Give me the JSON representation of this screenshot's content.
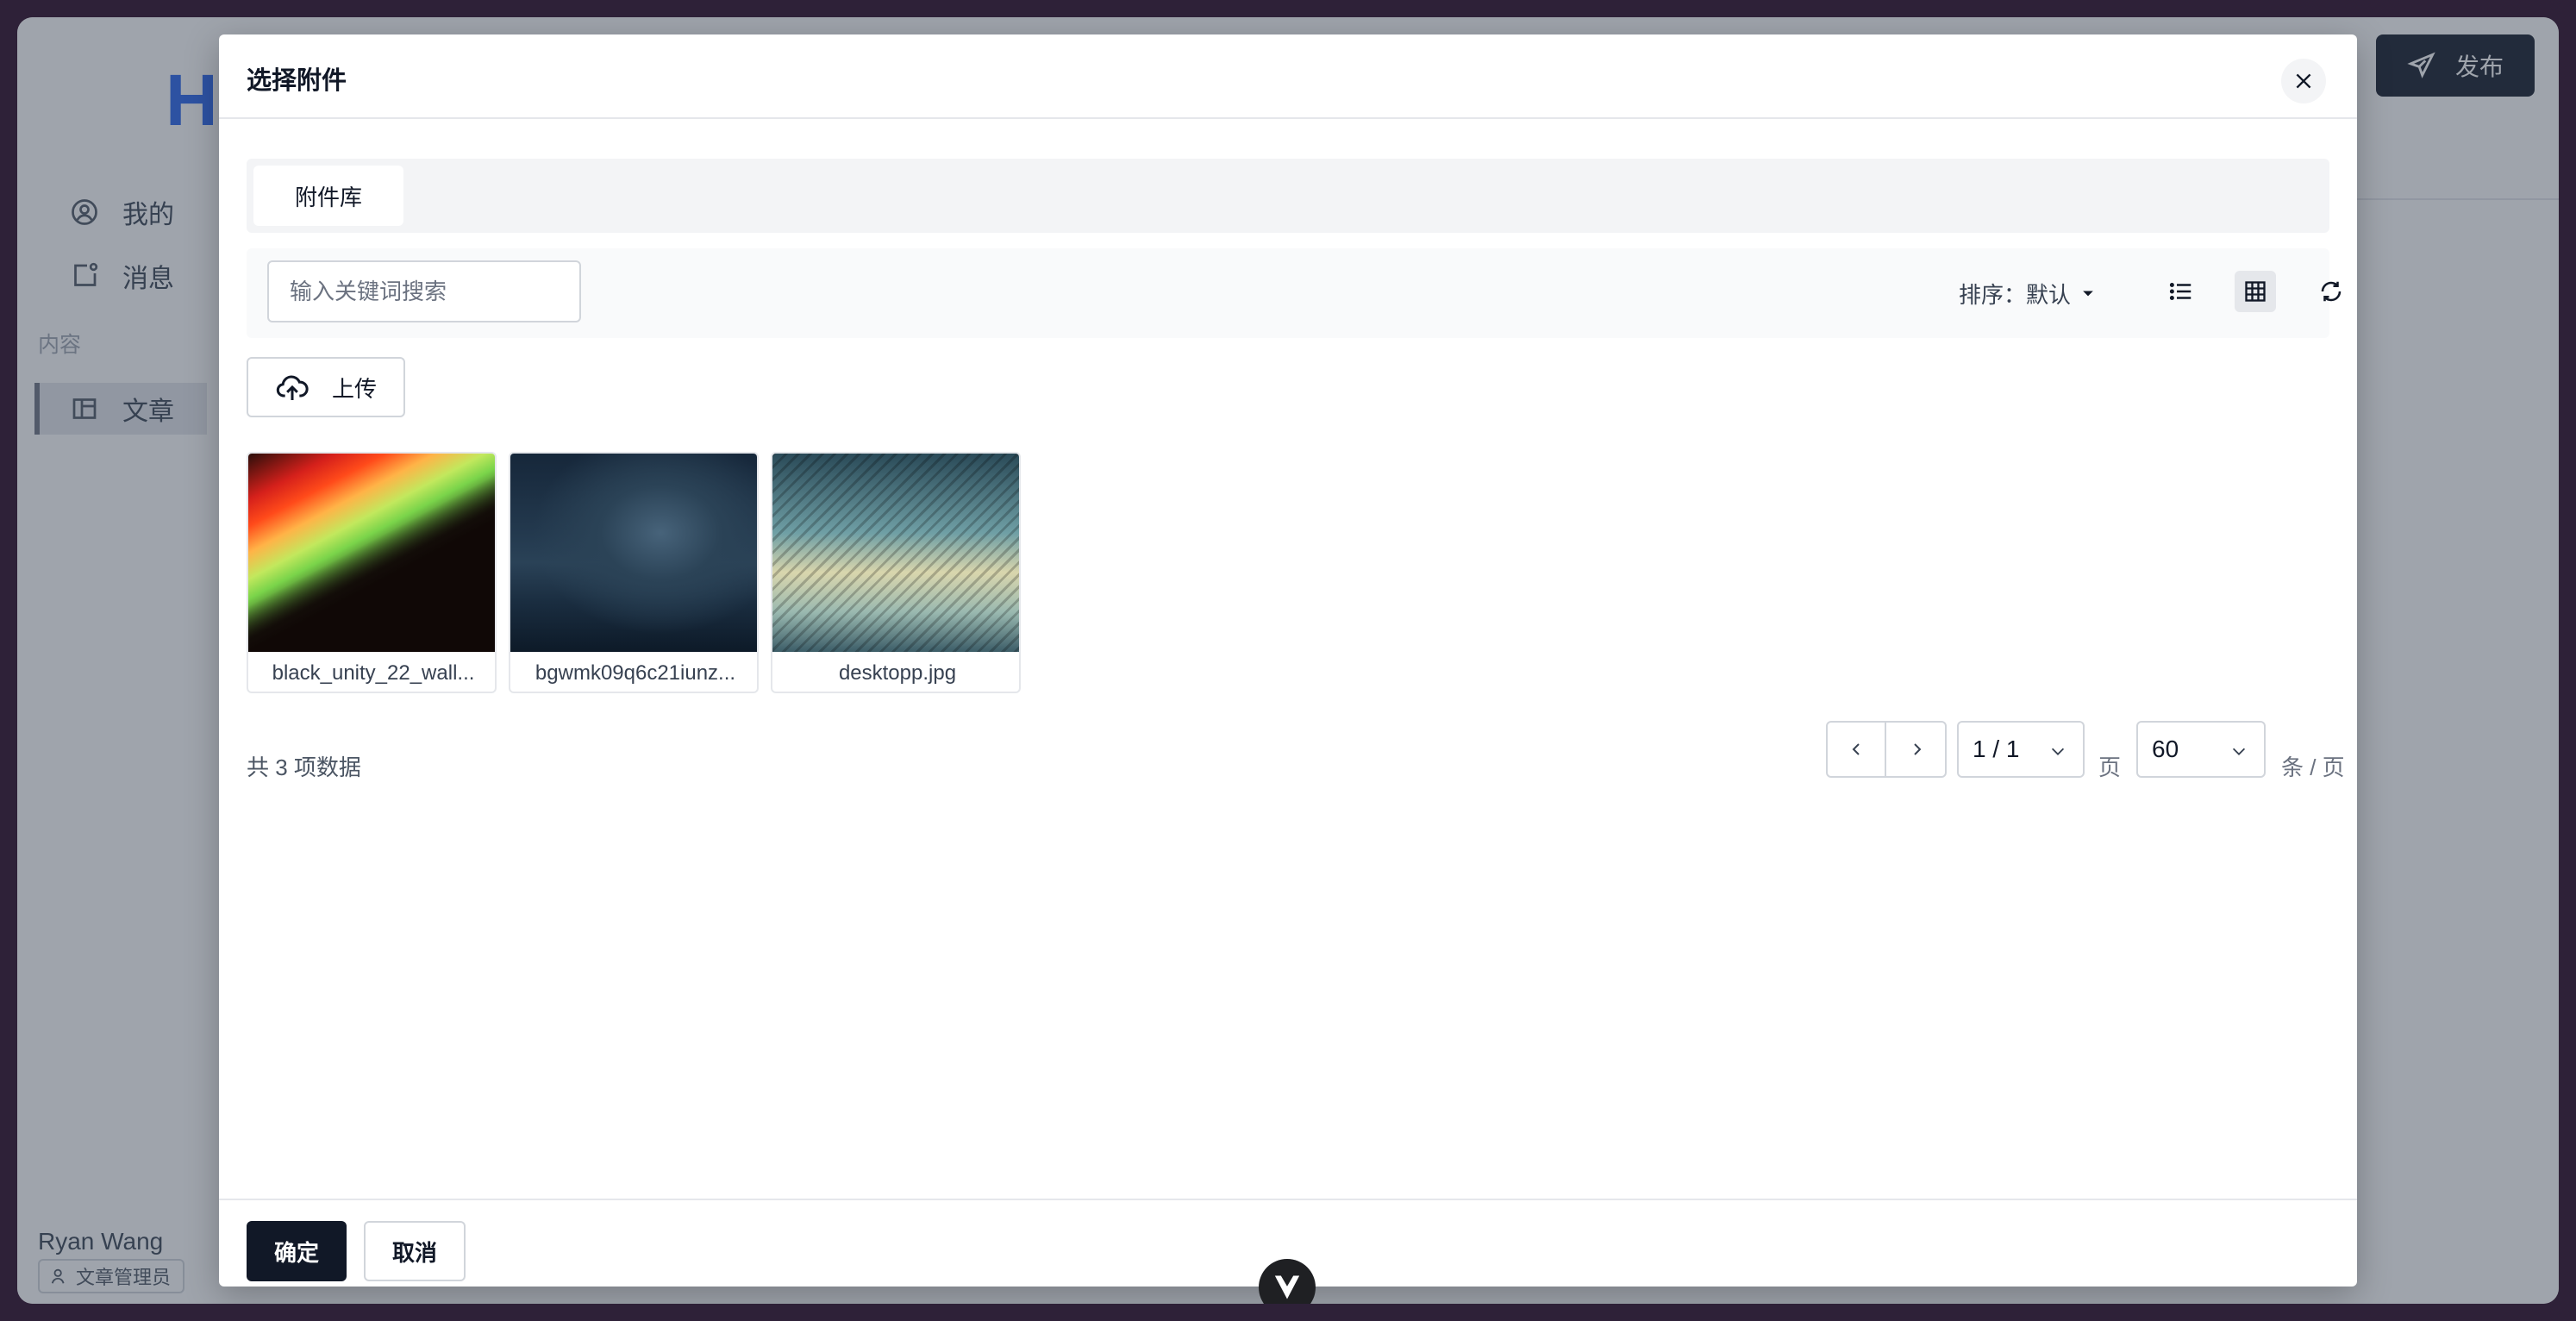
{
  "app": {
    "logo_letter": "H",
    "sidebar": {
      "items": [
        {
          "label": "我的",
          "icon": "user-circle-icon"
        },
        {
          "label": "消息",
          "icon": "notification-icon"
        },
        {
          "label": "文章",
          "icon": "layout-icon"
        }
      ],
      "group_label": "内容"
    },
    "user": {
      "name": "Ryan Wang",
      "role": "文章管理员"
    },
    "publish_label": "发布"
  },
  "modal": {
    "title": "选择附件",
    "tabs": [
      {
        "label": "附件库",
        "active": true
      }
    ],
    "search": {
      "placeholder": "输入关键词搜索",
      "value": ""
    },
    "sort": {
      "label": "排序：",
      "value": "默认"
    },
    "view_mode": "grid",
    "upload_label": "上传",
    "attachments": [
      {
        "name": "black_unity_22_wall..."
      },
      {
        "name": "bgwmk09q6c21iunz..."
      },
      {
        "name": "desktopp.jpg"
      }
    ],
    "pagination": {
      "total_text": "共 3 项数据",
      "page_value": "1 / 1",
      "page_unit": "页",
      "size_value": "60",
      "size_unit": "条 / 页"
    },
    "footer": {
      "confirm_label": "确定",
      "cancel_label": "取消"
    }
  },
  "colors": {
    "primary": "#111827",
    "accent": "#2563eb",
    "overlay": "#374151"
  }
}
